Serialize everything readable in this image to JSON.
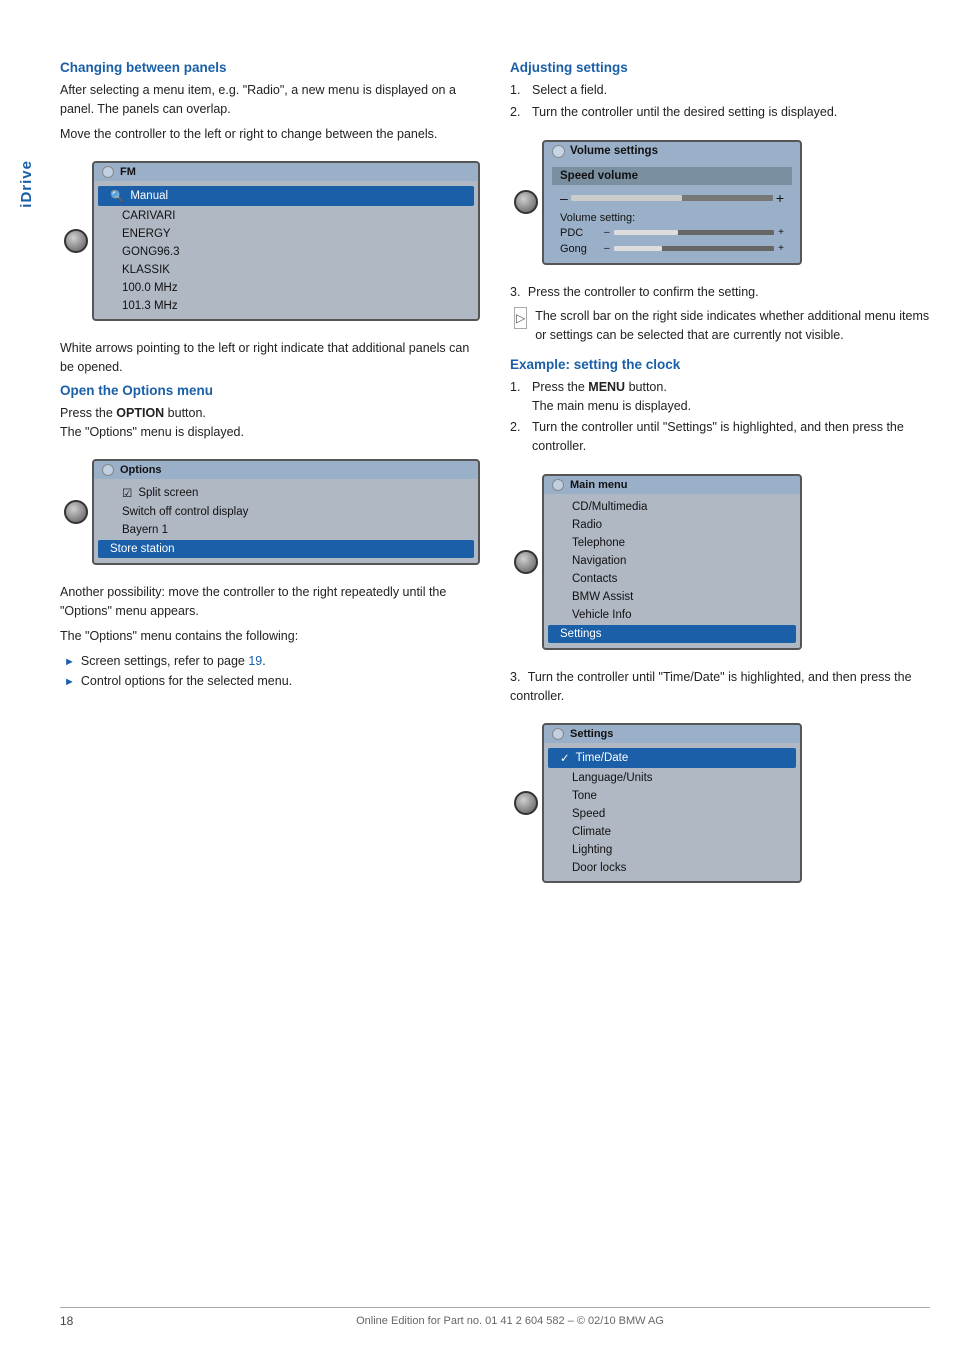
{
  "sidebar": {
    "label": "iDrive"
  },
  "left_col": {
    "section1": {
      "heading": "Changing between panels",
      "para1": "After selecting a menu item, e.g. \"Radio\", a new menu is displayed on a panel. The panels can overlap.",
      "para2": "Move the controller to the left or right to change between the panels.",
      "fm_screen": {
        "titlebar": "FM",
        "rows": [
          "Manual",
          "CARIVARI",
          "ENERGY",
          "GONG96.3",
          "KLASSIK",
          "100.0 MHz",
          "101.3 MHz"
        ]
      },
      "caption": "White arrows pointing to the left or right indicate that additional panels can be opened."
    },
    "section2": {
      "heading": "Open the Options menu",
      "intro": "Press the",
      "button_label": "OPTION",
      "intro2": "button.",
      "sub1": "The \"Options\" menu is displayed.",
      "options_screen": {
        "titlebar": "Options",
        "rows": [
          {
            "text": "Split screen",
            "has_check": true
          },
          {
            "text": "Switch off control display",
            "has_check": false
          },
          {
            "text": "Bayern 1",
            "has_check": false
          },
          {
            "text": "Store station",
            "highlighted": true
          }
        ]
      },
      "para3": "Another possibility: move the controller to the right repeatedly until the \"Options\" menu appears.",
      "para4": "The \"Options\" menu contains the following:",
      "bullets": [
        {
          "text": "Screen settings, refer to page ",
          "link": "19",
          "after": "."
        },
        {
          "text": "Control options for the selected menu.",
          "link": "",
          "after": ""
        }
      ]
    }
  },
  "right_col": {
    "section1": {
      "heading": "Adjusting settings",
      "steps": [
        {
          "num": "1.",
          "text": "Select a field."
        },
        {
          "num": "2.",
          "text": "Turn the controller until the desired setting is displayed."
        }
      ],
      "volume_screen": {
        "titlebar": "Volume settings",
        "speed_label": "Speed volume",
        "setting_label": "Volume setting:",
        "items": [
          {
            "name": "PDC",
            "fill_pct": 40
          },
          {
            "name": "Gong",
            "fill_pct": 30
          }
        ]
      },
      "step3": {
        "num": "3.",
        "text": "Press the controller to confirm the setting."
      },
      "scroll_note": "The scroll bar on the right side indicates whether additional menu items or settings can be selected that are currently not visible."
    },
    "section2": {
      "heading": "Example: setting the clock",
      "steps": [
        {
          "num": "1.",
          "text_before": "Press the ",
          "bold": "MENU",
          "text_after": " button.\nThe main menu is displayed."
        },
        {
          "num": "2.",
          "text_before": "Turn the controller until \"Settings\" is highlighted, and then press the controller."
        }
      ],
      "main_menu_screen": {
        "titlebar": "Main menu",
        "rows": [
          "CD/Multimedia",
          "Radio",
          "Telephone",
          "Navigation",
          "Contacts",
          "BMW Assist",
          "Vehicle Info",
          "Settings"
        ],
        "highlighted_row": "Settings"
      },
      "step3": {
        "num": "3.",
        "text": "Turn the controller until \"Time/Date\" is highlighted, and then press the controller."
      },
      "settings_screen": {
        "titlebar": "Settings",
        "rows": [
          "Time/Date",
          "Language/Units",
          "Tone",
          "Speed",
          "Climate",
          "Lighting",
          "Door locks"
        ],
        "highlighted_row": "Time/Date",
        "has_check": "Time/Date"
      }
    }
  },
  "footer": {
    "page_number": "18",
    "text": "Online Edition for Part no. 01 41 2 604 582 – © 02/10 BMW AG"
  }
}
